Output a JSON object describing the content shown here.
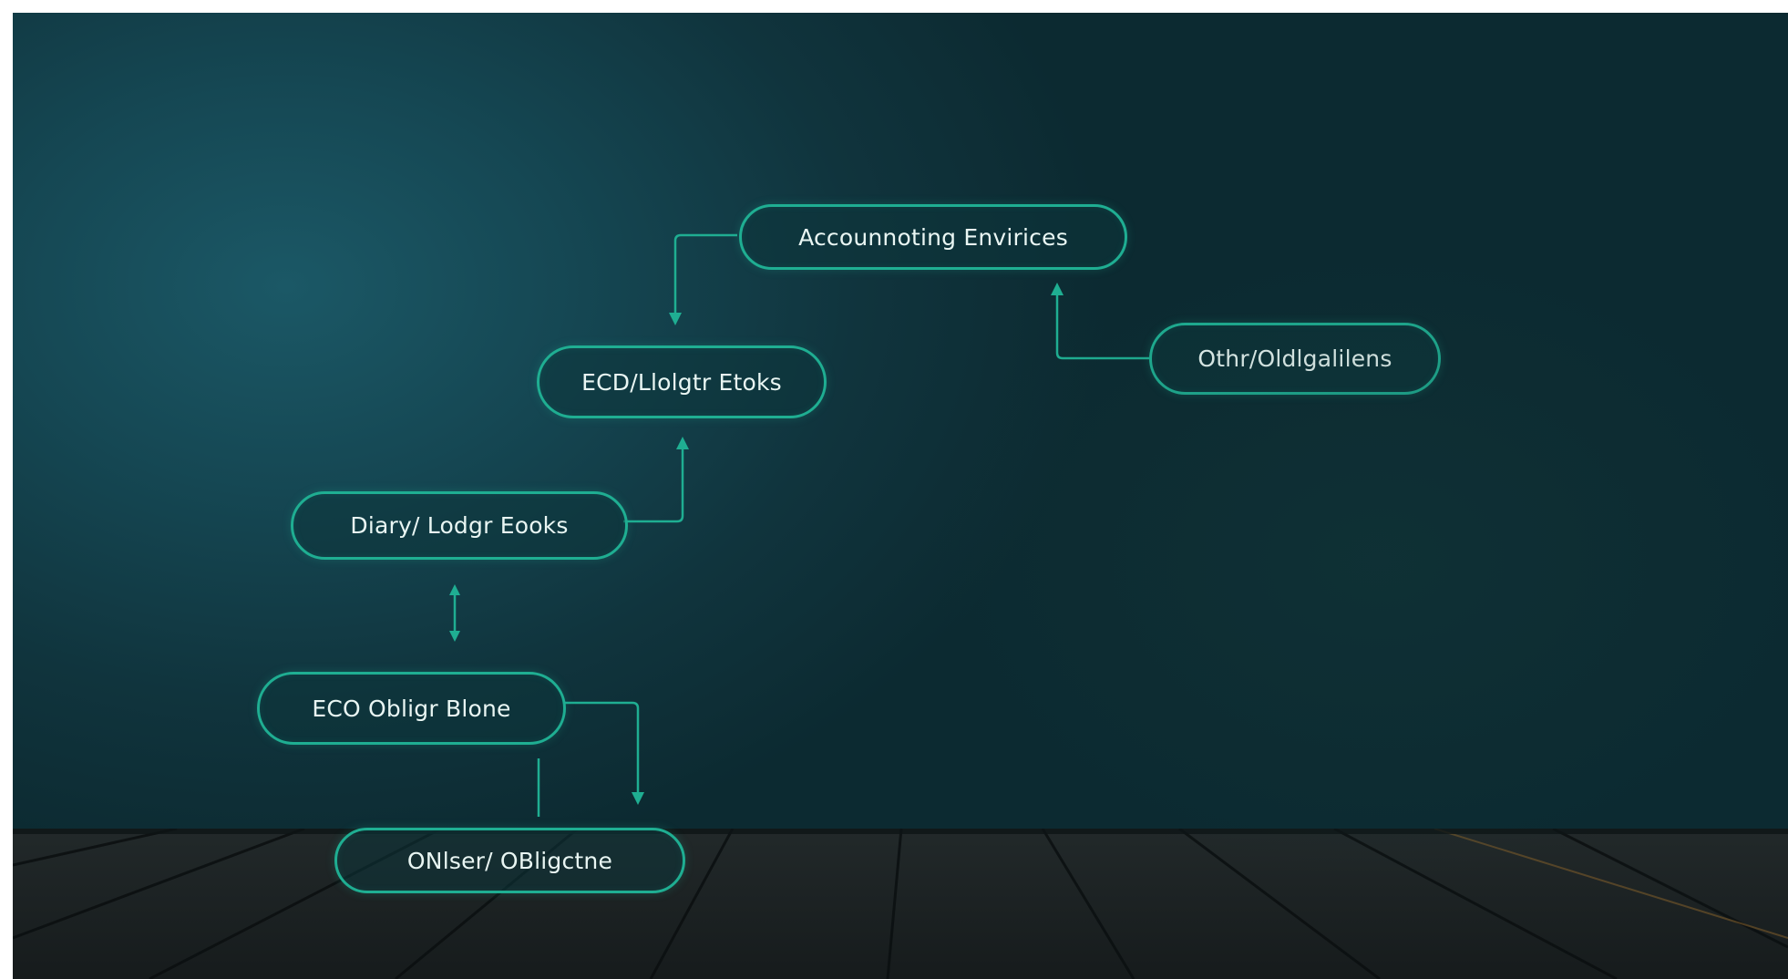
{
  "colors": {
    "background": "#133f49",
    "node_border": "#1fae92",
    "connector": "#1fae92",
    "text": "#e9f6f3",
    "floor": "#1d2324"
  },
  "nodes": {
    "accounting": "Accounnoting Envirices",
    "ecd_ledger": "ECD/Llolgtr Etoks",
    "other_obligations_right": "Othr/Oldlgalilens",
    "diary_ledger": "Diary/ Lodgr Eooks",
    "eco_obligations": "ECO Obligr Blone",
    "other_obligations_bottom": "ONlser/ OBligctne"
  }
}
